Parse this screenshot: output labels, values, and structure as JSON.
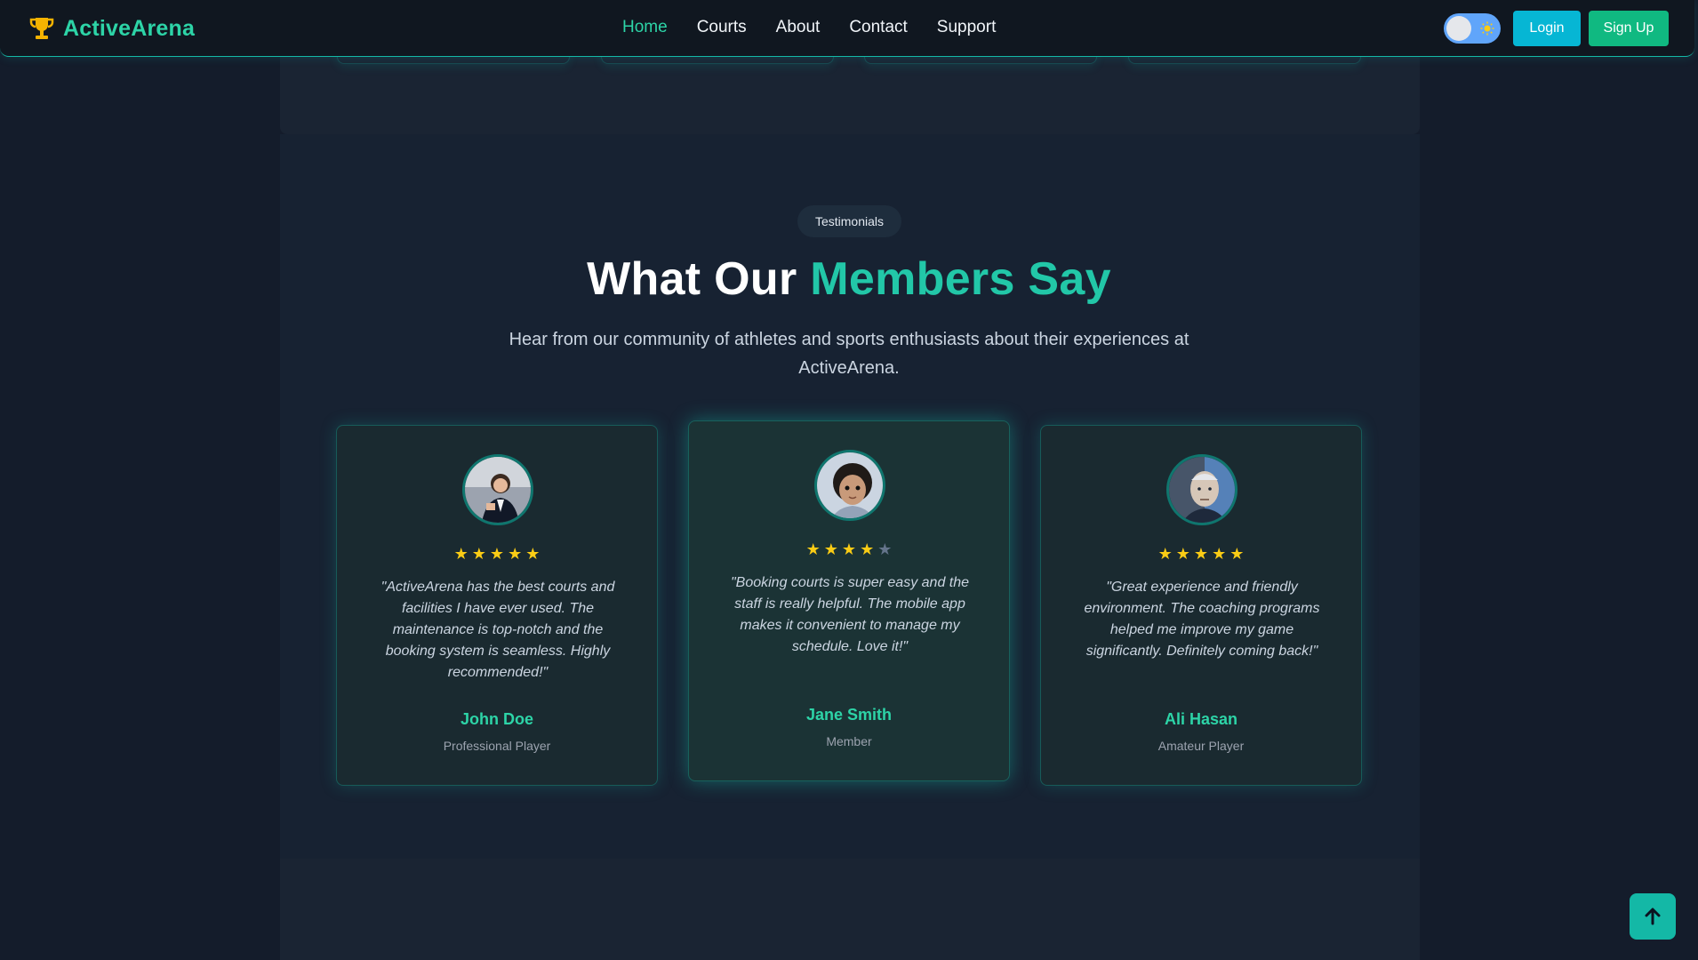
{
  "brand": {
    "name": "ActiveArena",
    "icon": "trophy-icon"
  },
  "nav": {
    "links": [
      "Home",
      "Courts",
      "About",
      "Contact",
      "Support"
    ],
    "active": "Home"
  },
  "auth": {
    "login_label": "Login",
    "signup_label": "Sign Up"
  },
  "theme_toggle": {
    "icon": "sun-icon"
  },
  "testimonials": {
    "badge": "Testimonials",
    "heading_plain": "What Our ",
    "heading_accent": "Members Say",
    "subheading": "Hear from our community of athletes and sports enthusiasts about their experiences at ActiveArena.",
    "cards": [
      {
        "quote": "\"ActiveArena has the best courts and facilities I have ever used. The maintenance is top-notch and the booking system is seamless. Highly recommended!\"",
        "name": "John Doe",
        "role": "Professional Player",
        "rating": 5
      },
      {
        "quote": "\"Booking courts is super easy and the staff is really helpful. The mobile app makes it convenient to manage my schedule. Love it!\"",
        "name": "Jane Smith",
        "role": "Member",
        "rating": 4
      },
      {
        "quote": "\"Great experience and friendly environment. The coaching programs helped me improve my game significantly. Definitely coming back!\"",
        "name": "Ali Hasan",
        "role": "Amateur Player",
        "rating": 5
      }
    ]
  },
  "colors": {
    "accent": "#22c7a8",
    "login": "#06b6d4",
    "signup": "#10b981",
    "star": "#facc15"
  }
}
